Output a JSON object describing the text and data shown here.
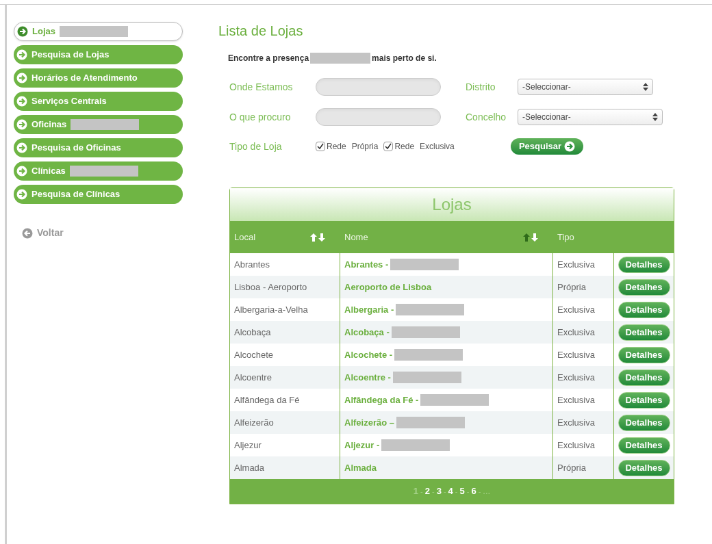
{
  "sidebar": {
    "items": [
      {
        "label": "Lojas",
        "redacted": true,
        "selected": true
      },
      {
        "label": "Pesquisa de Lojas",
        "redacted": false,
        "selected": false
      },
      {
        "label": "Horários de Atendimento",
        "redacted": false,
        "selected": false
      },
      {
        "label": "Serviços Centrais",
        "redacted": false,
        "selected": false
      },
      {
        "label": "Oficinas",
        "redacted": true,
        "selected": false
      },
      {
        "label": "Pesquisa de Oficinas",
        "redacted": false,
        "selected": false
      },
      {
        "label": "Clínicas",
        "redacted": true,
        "selected": false
      },
      {
        "label": "Pesquisa de Clínicas",
        "redacted": false,
        "selected": false
      }
    ],
    "back": "Voltar"
  },
  "title": "Lista de Lojas",
  "intro": {
    "before": "Encontre a presença",
    "after": "mais perto de si."
  },
  "form": {
    "where_label": "Onde Estamos",
    "what_label": "O que procuro",
    "district_label": "Distrito",
    "district_value": "-Seleccionar-",
    "council_label": "Concelho",
    "council_value": "-Seleccionar-",
    "type_label": "Tipo de Loja",
    "options": [
      {
        "label_1": "Rede",
        "label_2": "Própria",
        "checked": true
      },
      {
        "label_1": "Rede",
        "label_2": "Exclusiva",
        "checked": true
      }
    ],
    "search_button": "Pesquisar"
  },
  "table": {
    "title": "Lojas",
    "columns": [
      {
        "label": "Local",
        "sortable": true,
        "up_active": false
      },
      {
        "label": "Nome",
        "sortable": true,
        "up_active": true
      },
      {
        "label": "Tipo",
        "sortable": false
      }
    ],
    "rows": [
      {
        "local": "Abrantes",
        "name": "Abrantes -",
        "redacted": true,
        "type": "Exclusiva",
        "action": "Detalhes"
      },
      {
        "local": "Lisboa - Aeroporto",
        "name": "Aeroporto de Lisboa",
        "redacted": false,
        "type": "Própria",
        "action": "Detalhes"
      },
      {
        "local": "Albergaria-a-Velha",
        "name": "Albergaria -",
        "redacted": true,
        "type": "Exclusiva",
        "action": "Detalhes"
      },
      {
        "local": "Alcobaça",
        "name": "Alcobaça -",
        "redacted": true,
        "type": "Exclusiva",
        "action": "Detalhes"
      },
      {
        "local": "Alcochete",
        "name": "Alcochete -",
        "redacted": true,
        "type": "Exclusiva",
        "action": "Detalhes"
      },
      {
        "local": "Alcoentre",
        "name": "Alcoentre -",
        "redacted": true,
        "type": "Exclusiva",
        "action": "Detalhes"
      },
      {
        "local": "Alfândega da Fé",
        "name": "Alfândega da Fé -",
        "redacted": true,
        "type": "Exclusiva",
        "action": "Detalhes"
      },
      {
        "local": "Alfeizerão",
        "name": "Alfeizerão –",
        "redacted": true,
        "type": "Exclusiva",
        "action": "Detalhes"
      },
      {
        "local": "Aljezur",
        "name": "Aljezur -",
        "redacted": true,
        "type": "Exclusiva",
        "action": "Detalhes"
      },
      {
        "local": "Almada",
        "name": "Almada",
        "redacted": false,
        "type": "Própria",
        "action": "Detalhes"
      }
    ],
    "pagination": {
      "pages": [
        {
          "label": "1",
          "selected": true
        },
        {
          "label": "2",
          "selected": false
        },
        {
          "label": "3",
          "selected": false
        },
        {
          "label": "4",
          "selected": false
        },
        {
          "label": "5",
          "selected": false
        },
        {
          "label": "6",
          "selected": false
        }
      ],
      "separator": "-",
      "more": "..."
    }
  }
}
